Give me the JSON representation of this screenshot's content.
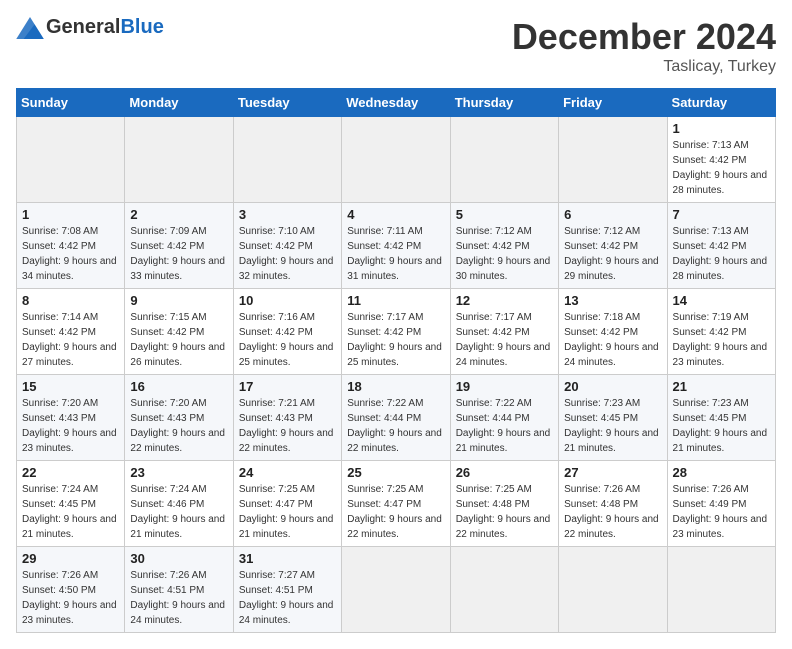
{
  "header": {
    "logo_general": "General",
    "logo_blue": "Blue",
    "month_title": "December 2024",
    "location": "Taslicay, Turkey"
  },
  "calendar": {
    "days_of_week": [
      "Sunday",
      "Monday",
      "Tuesday",
      "Wednesday",
      "Thursday",
      "Friday",
      "Saturday"
    ],
    "weeks": [
      [
        null,
        null,
        null,
        null,
        null,
        null,
        {
          "day": 1,
          "sunrise": "7:13 AM",
          "sunset": "4:42 PM",
          "daylight": "9 hours and 28 minutes."
        }
      ],
      [
        {
          "day": 1,
          "sunrise": "7:08 AM",
          "sunset": "4:42 PM",
          "daylight": "9 hours and 34 minutes."
        },
        {
          "day": 2,
          "sunrise": "7:09 AM",
          "sunset": "4:42 PM",
          "daylight": "9 hours and 33 minutes."
        },
        {
          "day": 3,
          "sunrise": "7:10 AM",
          "sunset": "4:42 PM",
          "daylight": "9 hours and 32 minutes."
        },
        {
          "day": 4,
          "sunrise": "7:11 AM",
          "sunset": "4:42 PM",
          "daylight": "9 hours and 31 minutes."
        },
        {
          "day": 5,
          "sunrise": "7:12 AM",
          "sunset": "4:42 PM",
          "daylight": "9 hours and 30 minutes."
        },
        {
          "day": 6,
          "sunrise": "7:12 AM",
          "sunset": "4:42 PM",
          "daylight": "9 hours and 29 minutes."
        },
        {
          "day": 7,
          "sunrise": "7:13 AM",
          "sunset": "4:42 PM",
          "daylight": "9 hours and 28 minutes."
        }
      ],
      [
        {
          "day": 8,
          "sunrise": "7:14 AM",
          "sunset": "4:42 PM",
          "daylight": "9 hours and 27 minutes."
        },
        {
          "day": 9,
          "sunrise": "7:15 AM",
          "sunset": "4:42 PM",
          "daylight": "9 hours and 26 minutes."
        },
        {
          "day": 10,
          "sunrise": "7:16 AM",
          "sunset": "4:42 PM",
          "daylight": "9 hours and 25 minutes."
        },
        {
          "day": 11,
          "sunrise": "7:17 AM",
          "sunset": "4:42 PM",
          "daylight": "9 hours and 25 minutes."
        },
        {
          "day": 12,
          "sunrise": "7:17 AM",
          "sunset": "4:42 PM",
          "daylight": "9 hours and 24 minutes."
        },
        {
          "day": 13,
          "sunrise": "7:18 AM",
          "sunset": "4:42 PM",
          "daylight": "9 hours and 24 minutes."
        },
        {
          "day": 14,
          "sunrise": "7:19 AM",
          "sunset": "4:42 PM",
          "daylight": "9 hours and 23 minutes."
        }
      ],
      [
        {
          "day": 15,
          "sunrise": "7:20 AM",
          "sunset": "4:43 PM",
          "daylight": "9 hours and 23 minutes."
        },
        {
          "day": 16,
          "sunrise": "7:20 AM",
          "sunset": "4:43 PM",
          "daylight": "9 hours and 22 minutes."
        },
        {
          "day": 17,
          "sunrise": "7:21 AM",
          "sunset": "4:43 PM",
          "daylight": "9 hours and 22 minutes."
        },
        {
          "day": 18,
          "sunrise": "7:22 AM",
          "sunset": "4:44 PM",
          "daylight": "9 hours and 22 minutes."
        },
        {
          "day": 19,
          "sunrise": "7:22 AM",
          "sunset": "4:44 PM",
          "daylight": "9 hours and 21 minutes."
        },
        {
          "day": 20,
          "sunrise": "7:23 AM",
          "sunset": "4:45 PM",
          "daylight": "9 hours and 21 minutes."
        },
        {
          "day": 21,
          "sunrise": "7:23 AM",
          "sunset": "4:45 PM",
          "daylight": "9 hours and 21 minutes."
        }
      ],
      [
        {
          "day": 22,
          "sunrise": "7:24 AM",
          "sunset": "4:45 PM",
          "daylight": "9 hours and 21 minutes."
        },
        {
          "day": 23,
          "sunrise": "7:24 AM",
          "sunset": "4:46 PM",
          "daylight": "9 hours and 21 minutes."
        },
        {
          "day": 24,
          "sunrise": "7:25 AM",
          "sunset": "4:47 PM",
          "daylight": "9 hours and 21 minutes."
        },
        {
          "day": 25,
          "sunrise": "7:25 AM",
          "sunset": "4:47 PM",
          "daylight": "9 hours and 22 minutes."
        },
        {
          "day": 26,
          "sunrise": "7:25 AM",
          "sunset": "4:48 PM",
          "daylight": "9 hours and 22 minutes."
        },
        {
          "day": 27,
          "sunrise": "7:26 AM",
          "sunset": "4:48 PM",
          "daylight": "9 hours and 22 minutes."
        },
        {
          "day": 28,
          "sunrise": "7:26 AM",
          "sunset": "4:49 PM",
          "daylight": "9 hours and 23 minutes."
        }
      ],
      [
        {
          "day": 29,
          "sunrise": "7:26 AM",
          "sunset": "4:50 PM",
          "daylight": "9 hours and 23 minutes."
        },
        {
          "day": 30,
          "sunrise": "7:26 AM",
          "sunset": "4:51 PM",
          "daylight": "9 hours and 24 minutes."
        },
        {
          "day": 31,
          "sunrise": "7:27 AM",
          "sunset": "4:51 PM",
          "daylight": "9 hours and 24 minutes."
        },
        null,
        null,
        null,
        null
      ]
    ]
  }
}
